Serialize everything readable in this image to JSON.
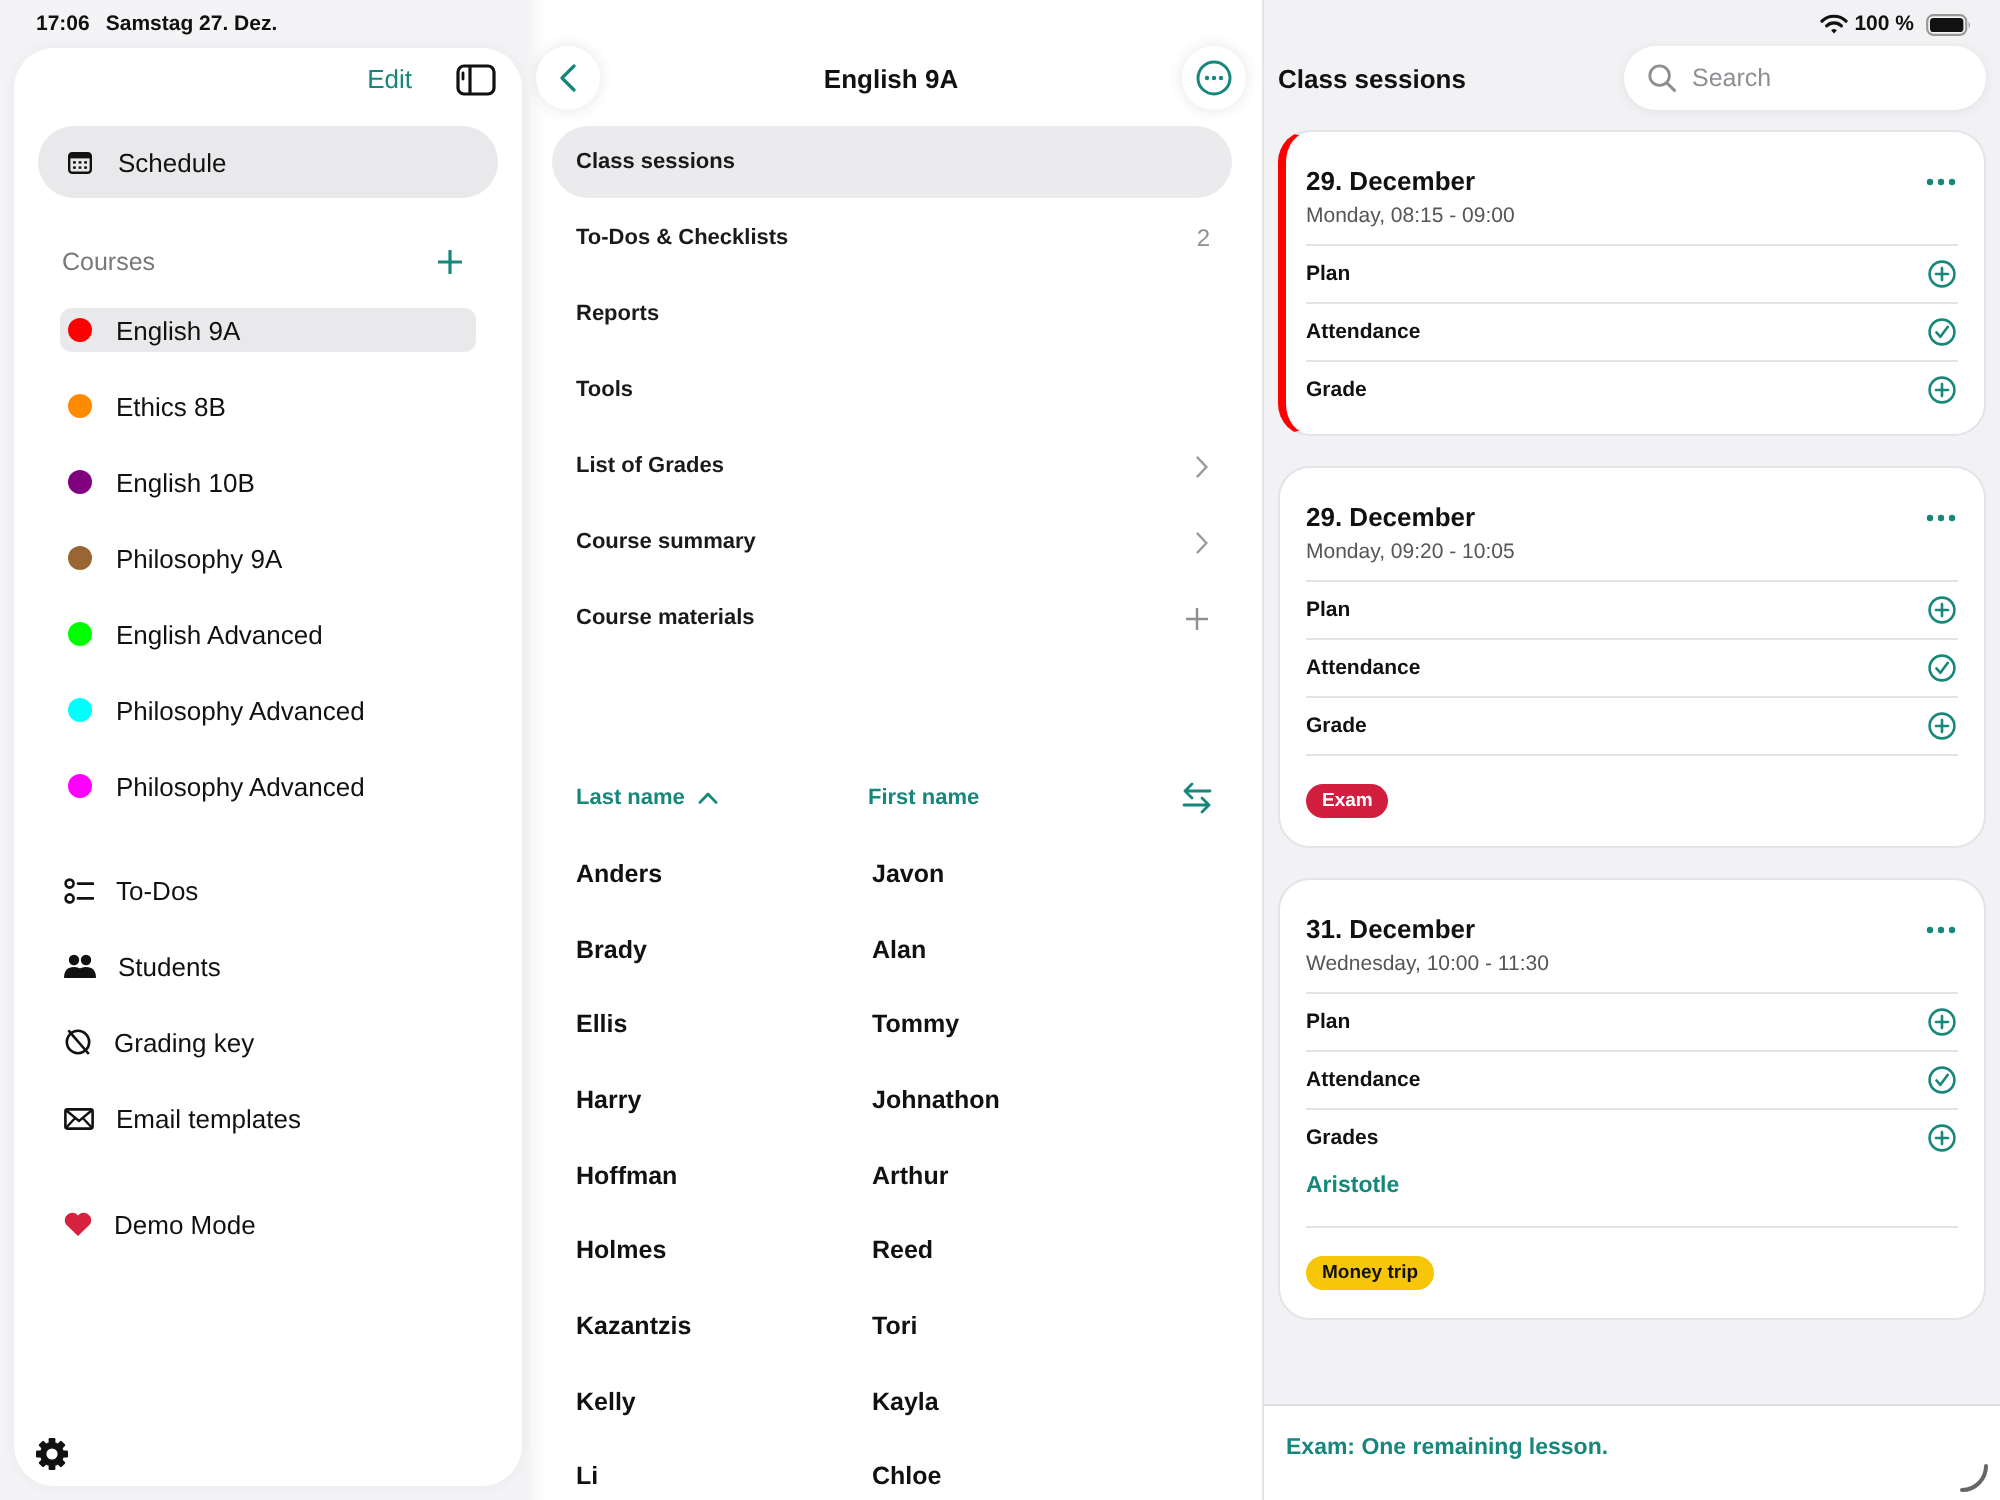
{
  "status_bar": {
    "time": "17:06",
    "date": "Samstag 27. Dez.",
    "battery": "100 %"
  },
  "sidebar": {
    "edit": "Edit",
    "schedule": "Schedule",
    "courses": {
      "title": "Courses",
      "items": [
        {
          "label": "English 9A",
          "color": "#ff0000",
          "selected": true
        },
        {
          "label": "Ethics 8B",
          "color": "#ff8a00",
          "selected": false
        },
        {
          "label": "English 10B",
          "color": "#800080",
          "selected": false
        },
        {
          "label": "Philosophy 9A",
          "color": "#996633",
          "selected": false
        },
        {
          "label": "English Advanced",
          "color": "#00ff00",
          "selected": false
        },
        {
          "label": "Philosophy Advanced",
          "color": "#00ffff",
          "selected": false
        },
        {
          "label": "Philosophy Advanced",
          "color": "#ff00ff",
          "selected": false
        }
      ]
    },
    "tools": [
      {
        "label": "To-Dos"
      },
      {
        "label": "Students"
      },
      {
        "label": "Grading key"
      },
      {
        "label": "Email templates"
      }
    ],
    "demo": {
      "label": "Demo Mode"
    }
  },
  "course_panel": {
    "title": "English 9A",
    "menu": [
      {
        "kind": "plain",
        "label": "Class sessions",
        "selected": true
      },
      {
        "kind": "count",
        "label": "To-Dos & Checklists",
        "selected": false,
        "count": "2"
      },
      {
        "kind": "plain",
        "label": "Reports",
        "selected": false
      },
      {
        "kind": "plain",
        "label": "Tools",
        "selected": false
      },
      {
        "kind": "link",
        "label": "List of Grades",
        "selected": false
      },
      {
        "kind": "link",
        "label": "Course summary",
        "selected": false
      },
      {
        "kind": "add",
        "label": "Course materials",
        "selected": false
      }
    ],
    "students": {
      "columns": [
        {
          "label": "Last name",
          "sorted": true
        },
        {
          "label": "First name",
          "sorted": false
        }
      ],
      "rows": [
        [
          "Anders",
          "Javon"
        ],
        [
          "Brady",
          "Alan"
        ],
        [
          "Ellis",
          "Tommy"
        ],
        [
          "Harry",
          "Johnathon"
        ],
        [
          "Hoffman",
          "Arthur"
        ],
        [
          "Holmes",
          "Reed"
        ],
        [
          "Kazantzis",
          "Tori"
        ],
        [
          "Kelly",
          "Kayla"
        ],
        [
          "Li",
          "Chloe"
        ]
      ]
    }
  },
  "sessions_panel": {
    "title": "Class sessions",
    "search": {
      "placeholder": "Search"
    },
    "sessions": [
      {
        "date": "29. December",
        "time": "Monday, 08:15 - 09:00",
        "current": true,
        "items": [
          {
            "label": "Plan",
            "done": false
          },
          {
            "label": "Attendance",
            "done": true
          },
          {
            "label": "Grade",
            "done": false
          }
        ]
      },
      {
        "date": "29. December",
        "time": "Monday, 09:20 - 10:05",
        "current": false,
        "items": [
          {
            "label": "Plan",
            "done": false
          },
          {
            "label": "Attendance",
            "done": true
          },
          {
            "label": "Grade",
            "done": false
          }
        ],
        "tags": [
          {
            "label": "Exam",
            "color": "#d21f3f"
          }
        ]
      },
      {
        "date": "31. December",
        "time": "Wednesday, 10:00 - 11:30",
        "current": false,
        "items": [
          {
            "label": "Plan",
            "done": false
          },
          {
            "label": "Attendance",
            "done": true
          },
          {
            "label": "Grades",
            "done": false,
            "entries": [
              "Aristotle"
            ]
          }
        ],
        "tags": [
          {
            "label": "Money trip",
            "color": "#f8c608"
          }
        ]
      }
    ],
    "footer": {
      "message": "Exam: One remaining lesson."
    }
  }
}
